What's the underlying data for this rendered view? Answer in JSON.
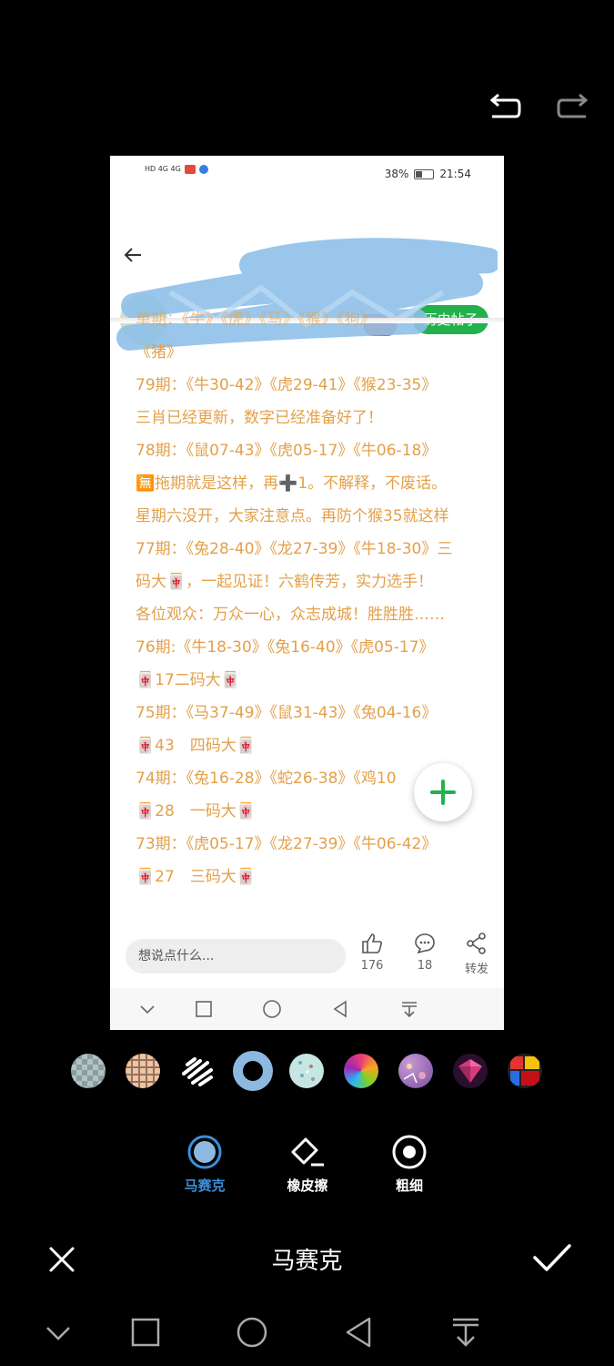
{
  "editor": {
    "title": "马赛克",
    "tools": [
      {
        "label": "马赛克",
        "icon": "mosaic-icon",
        "active": true
      },
      {
        "label": "橡皮擦",
        "icon": "eraser-icon",
        "active": false
      },
      {
        "label": "粗细",
        "icon": "thickness-icon",
        "active": false
      }
    ],
    "accent": "#3b8fd8",
    "mosaic_styles": [
      "blur-pixel",
      "skin-grid",
      "brush-stroke",
      "blue-ring",
      "dots",
      "color-tiles",
      "purple-pattern",
      "pink-crystal",
      "color-blocks"
    ],
    "selected_style": 3
  },
  "preview": {
    "status": {
      "left": "HD 4G 4G",
      "battery": "38%",
      "time": "21:54"
    },
    "history_button": "历史帖子",
    "post_lines": [
      "单期：《牛》《虎》《马》《猴》《狗》",
      "《猪》",
      "79期：《牛30-42》《虎29-41》《猴23-35》",
      "三肖已经更新，数字已经准备好了！",
      "78期：《鼠07-43》《虎05-17》《牛06-18》",
      "🈚拖期就是这样，再➕1。不解释，不废话。",
      "星期六没开，大家注意点。再防个猴35就这样",
      "77期：《兔28-40》《龙27-39》《牛18-30》三",
      "码大🀄，一起见证！六鹤传芳，实力选手！",
      "各位观众：万众一心，众志成城！胜胜胜……",
      "76期:《牛18-30》《兔16-40》《虎05-17》",
      "🀄17二码大🀄",
      "75期：《马37-49》《鼠31-43》《兔04-16》",
      "🀄43　四码大🀄",
      "74期：《兔16-28》《蛇26-38》《鸡10",
      "🀄28　一码大🀄",
      "73期：《虎05-17》《龙27-39》《牛06-42》",
      "🀄27　三码大🀄"
    ],
    "comment_placeholder": "想说点什么...",
    "likes": "176",
    "comments": "18",
    "share": "转发",
    "text_color": "#e3a04a",
    "button_color": "#22b14c"
  }
}
